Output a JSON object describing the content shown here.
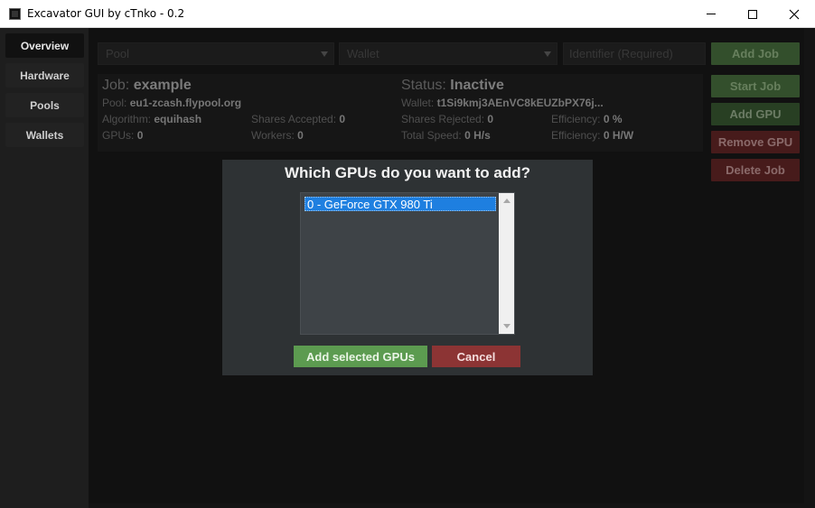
{
  "window": {
    "title": "Excavator GUI by cTnko - 0.2"
  },
  "sidebar": {
    "items": [
      {
        "label": "Overview",
        "active": true
      },
      {
        "label": "Hardware",
        "active": false
      },
      {
        "label": "Pools",
        "active": false
      },
      {
        "label": "Wallets",
        "active": false
      }
    ]
  },
  "toolbar": {
    "pool_placeholder": "Pool",
    "wallet_placeholder": "Wallet",
    "identifier_placeholder": "Identifier (Required)",
    "add_job": "Add Job"
  },
  "actions": {
    "start_job": "Start Job",
    "add_gpu": "Add GPU",
    "remove_gpu": "Remove GPU",
    "delete_job": "Delete Job"
  },
  "job": {
    "job_label": "Job:",
    "job_name": "example",
    "status_label": "Status:",
    "status_value": "Inactive",
    "pool_label": "Pool:",
    "pool_value": "eu1-zcash.flypool.org",
    "wallet_label": "Wallet:",
    "wallet_value": "t1Si9kmj3AEnVC8kEUZbPX76j...",
    "algorithm_label": "Algorithm:",
    "algorithm_value": "equihash",
    "shares_accepted_label": "Shares Accepted:",
    "shares_accepted_value": "0",
    "shares_rejected_label": "Shares Rejected:",
    "shares_rejected_value": "0",
    "efficiency_label": "Efficiency:",
    "efficiency_value": "0 %",
    "gpus_label": "GPUs:",
    "gpus_value": "0",
    "workers_label": "Workers:",
    "workers_value": "0",
    "total_speed_label": "Total Speed:",
    "total_speed_value": "0 H/s",
    "efficiency2_label": "Efficiency:",
    "efficiency2_value": "0 H/W"
  },
  "dialog": {
    "title": "Which GPUs do you want to add?",
    "gpus": [
      "0 - GeForce GTX 980 Ti"
    ],
    "add_button": "Add selected GPUs",
    "cancel_button": "Cancel"
  },
  "colors": {
    "accent_green": "#4f7a44",
    "accent_red": "#6d2a2a",
    "selection_blue": "#1e7fe0"
  }
}
